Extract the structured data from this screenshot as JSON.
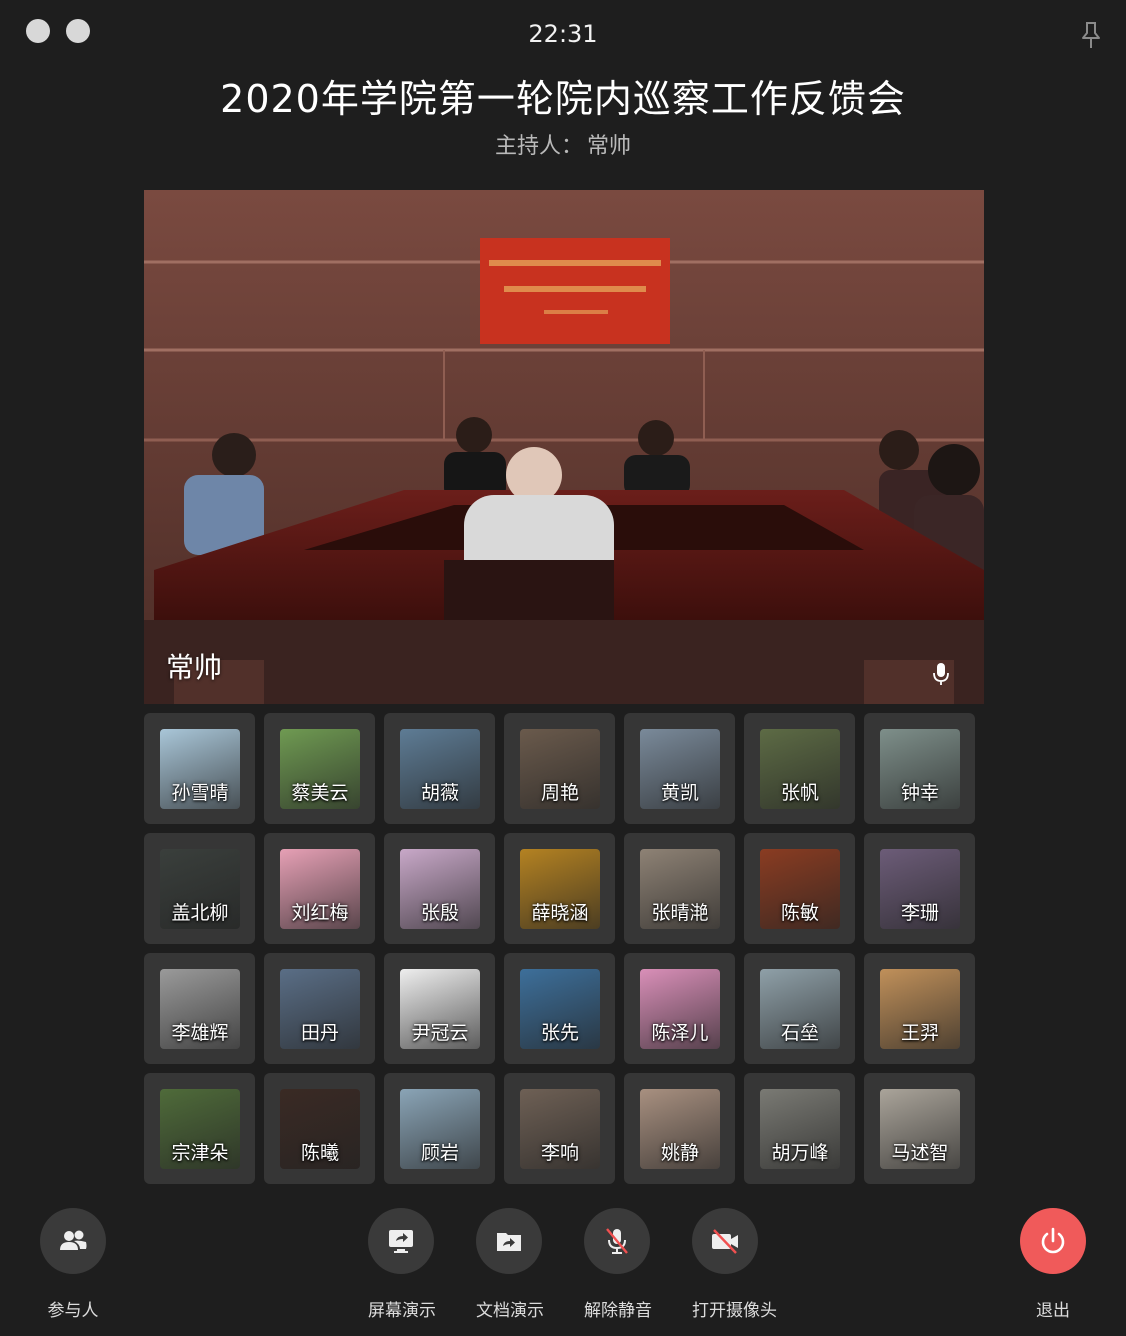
{
  "time": "22:31",
  "meeting_title": "2020年学院第一轮院内巡察工作反馈会",
  "host_label": "主持人：",
  "host_name": "常帅",
  "main_video": {
    "speaker_name": "常帅"
  },
  "participants": [
    {
      "name": "孙雪晴",
      "color": "#a9c6d8"
    },
    {
      "name": "蔡美云",
      "color": "#6f9a52"
    },
    {
      "name": "胡薇",
      "color": "#5e7c95"
    },
    {
      "name": "周艳",
      "color": "#6a5a4c"
    },
    {
      "name": "黄凯",
      "color": "#7a8a9a"
    },
    {
      "name": "张帆",
      "color": "#5d6b45"
    },
    {
      "name": "钟幸",
      "color": "#7e8f8a"
    },
    {
      "name": "盖北柳",
      "color": "#3a3f3c"
    },
    {
      "name": "刘红梅",
      "color": "#e6a0b5"
    },
    {
      "name": "张殷",
      "color": "#c8a8c8"
    },
    {
      "name": "薛晓涵",
      "color": "#b48222"
    },
    {
      "name": "张晴滟",
      "color": "#8e8275"
    },
    {
      "name": "陈敏",
      "color": "#8a3c22"
    },
    {
      "name": "李珊",
      "color": "#6c5c78"
    },
    {
      "name": "李雄辉",
      "color": "#9a9a9a"
    },
    {
      "name": "田丹",
      "color": "#5a6e86"
    },
    {
      "name": "尹冠云",
      "color": "#eeeeee"
    },
    {
      "name": "张先",
      "color": "#3d6f9a"
    },
    {
      "name": "陈泽儿",
      "color": "#d98fb8"
    },
    {
      "name": "石垒",
      "color": "#8fa0a8"
    },
    {
      "name": "王羿",
      "color": "#c0905a"
    },
    {
      "name": "宗津朵",
      "color": "#4f6b3a"
    },
    {
      "name": "陈曦",
      "color": "#3a2a24"
    },
    {
      "name": "顾岩",
      "color": "#8aa4b6"
    },
    {
      "name": "李响",
      "color": "#6e6055"
    },
    {
      "name": "姚静",
      "color": "#a89080"
    },
    {
      "name": "胡万峰",
      "color": "#7a7a74"
    },
    {
      "name": "马述智",
      "color": "#aaa49a"
    }
  ],
  "toolbar": {
    "participants": "参与人",
    "screen_share": "屏幕演示",
    "doc_share": "文档演示",
    "unmute": "解除静音",
    "camera_on": "打开摄像头",
    "exit": "退出"
  }
}
